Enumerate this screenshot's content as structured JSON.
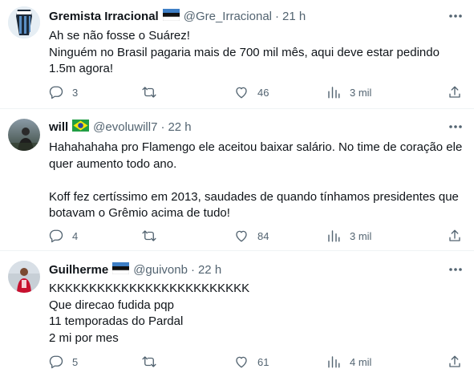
{
  "tweets": [
    {
      "name": "Gremista Irracional",
      "handle": "@Gre_Irracional",
      "time": "21 h",
      "flag": "estonia",
      "lines": [
        "Ah se não fosse o Suárez!",
        "Ninguém no Brasil pagaria mais de 700 mil mês, aqui deve estar pedindo",
        "1.5m agora!"
      ],
      "replies": "3",
      "retweets": "",
      "likes": "46",
      "views": "3 mil"
    },
    {
      "name": "will",
      "handle": "@evoluwill7",
      "time": "22 h",
      "flag": "brazil",
      "lines": [
        "Hahahahaha pro Flamengo ele aceitou baixar salário. No time de coração ele",
        "quer aumento todo ano.",
        "",
        "Koff fez certíssimo em 2013, saudades de quando tínhamos presidentes que",
        "botavam o Grêmio acima de tudo!"
      ],
      "replies": "4",
      "retweets": "",
      "likes": "84",
      "views": "3 mil"
    },
    {
      "name": "Guilherme",
      "handle": "@guivonb",
      "time": "22 h",
      "flag": "estonia",
      "lines": [
        "KKKKKKKKKKKKKKKKKKKKKKKKK",
        "Que direcao fudida pqp",
        "11 temporadas do Pardal",
        "2 mi por mes"
      ],
      "replies": "5",
      "retweets": "",
      "likes": "61",
      "views": "4 mil"
    }
  ],
  "separator": "·",
  "icons": [
    "more-icon",
    "reply-icon",
    "retweet-icon",
    "like-icon",
    "views-icon",
    "share-icon"
  ],
  "colors": {
    "text": "#0f1419",
    "secondary": "#536471",
    "border": "#eff3f4"
  }
}
